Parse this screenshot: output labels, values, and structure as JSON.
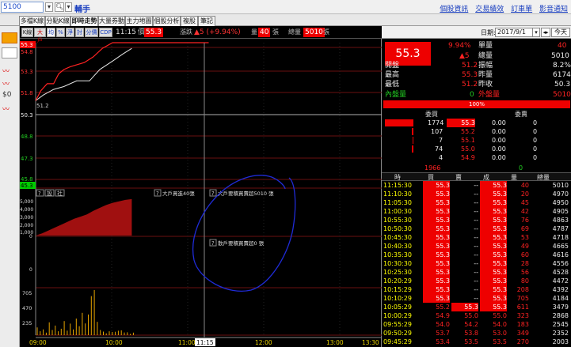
{
  "topbar": {
    "stock_code": "5100",
    "stock_name": "輔手",
    "links": [
      "個股資訊",
      "交易績效",
      "訂車單",
      "影音通知"
    ]
  },
  "tabs": [
    "多檔K線",
    "分點K線",
    "即時走勢",
    "大量券動",
    "主力地圖",
    "個股分析",
    "複股",
    "筆記"
  ],
  "active_tab": 2,
  "toolbar": {
    "buttons": [
      "K線",
      "大戶",
      "均",
      "%",
      "淨",
      "討",
      "分價",
      "CDP"
    ],
    "time": "11:15",
    "price_label": "價",
    "price_value": "55.3",
    "change_label": "漲跌",
    "change_value": "▲5 (+9.94%)",
    "vol_label": "量",
    "vol_value": "40",
    "vol_unit": "張",
    "total_label": "總量",
    "total_value": "5010",
    "total_unit": "張"
  },
  "chart": {
    "price_ticks": [
      "54.8",
      "53.3",
      "51.8",
      "50.3",
      "48.8",
      "47.3",
      "45.8"
    ],
    "top_price": "55.3",
    "bottom_price": "45.3",
    "start_label": "51.2",
    "panel2_ticks": [
      "5,000",
      "4,000",
      "3,000",
      "2,000",
      "1,000",
      "0"
    ],
    "panel2_buttons": [
      "?",
      "設",
      "社"
    ],
    "panel2_labels": [
      "大戶買進40張",
      "大戶要積買賣超5010 張"
    ],
    "panel3_label": "散戶要積買賣超0 張",
    "panel3_tick": "0",
    "vol_ticks": [
      "705",
      "470",
      "235"
    ],
    "time_ticks": [
      "09:00",
      "10:00",
      "11:00",
      "12:00",
      "13:00",
      "13:30"
    ],
    "cursor_time": "11:15"
  },
  "chart_data": {
    "type": "line",
    "x": [
      "09:00",
      "10:00",
      "11:00",
      "11:15"
    ],
    "series": [
      {
        "values": [
          51.2,
          53.9,
          55.3,
          55.3
        ]
      },
      {
        "values": [
          51.2,
          52.6,
          54.5,
          54.9
        ]
      }
    ],
    "ylim": [
      45.3,
      55.3
    ]
  },
  "right": {
    "date_label": "日期:",
    "date_value": "2017/9/1",
    "today_label": "今天",
    "big_price": "55.3",
    "pct": "9.94%",
    "change": "▲5",
    "single_vol_label": "單量",
    "single_vol": "40",
    "total_vol_label": "總量",
    "total_vol": "5010",
    "rows": [
      {
        "l": "開盤",
        "v": "51.2",
        "l2": "振幅",
        "v2": "8.2%"
      },
      {
        "l": "最高",
        "v": "55.3",
        "l2": "昨量",
        "v2": "6174"
      },
      {
        "l": "最低",
        "v": "51.2",
        "l2": "昨收",
        "v2": "50.3"
      }
    ],
    "inner_label": "內盤量",
    "inner_value": "0",
    "outer_label": "外盤量",
    "outer_value": "5010",
    "ratio": "100%",
    "buy_hdr": "委買",
    "sell_hdr": "委賣",
    "orderbook": [
      {
        "q": "1774",
        "p": "55.3",
        "sp": "0.00",
        "sq": "0"
      },
      {
        "q": "107",
        "p": "55.2",
        "sp": "0.00",
        "sq": "0"
      },
      {
        "q": "7",
        "p": "55.1",
        "sp": "0.00",
        "sq": "0"
      },
      {
        "q": "74",
        "p": "55.0",
        "sp": "0.00",
        "sq": "0"
      },
      {
        "q": "4",
        "p": "54.9",
        "sp": "0.00",
        "sq": "0"
      }
    ],
    "ob_total_buy": "1966",
    "ob_total_sell": "0",
    "tick_hdr": [
      "時",
      "買",
      "賣",
      "成",
      "量",
      "總量"
    ],
    "ticks": [
      [
        "11:15:30",
        "55.3",
        "--",
        "55.3",
        "40",
        "5010"
      ],
      [
        "11:10:30",
        "55.3",
        "--",
        "55.3",
        "20",
        "4970"
      ],
      [
        "11:05:30",
        "55.3",
        "--",
        "55.3",
        "45",
        "4950"
      ],
      [
        "11:00:30",
        "55.3",
        "--",
        "55.3",
        "42",
        "4905"
      ],
      [
        "10:55:30",
        "55.3",
        "--",
        "55.3",
        "76",
        "4863"
      ],
      [
        "10:50:30",
        "55.3",
        "--",
        "55.3",
        "69",
        "4787"
      ],
      [
        "10:45:30",
        "55.3",
        "--",
        "55.3",
        "53",
        "4718"
      ],
      [
        "10:40:30",
        "55.3",
        "--",
        "55.3",
        "49",
        "4665"
      ],
      [
        "10:35:30",
        "55.3",
        "--",
        "55.3",
        "60",
        "4616"
      ],
      [
        "10:30:30",
        "55.3",
        "--",
        "55.3",
        "28",
        "4556"
      ],
      [
        "10:25:30",
        "55.3",
        "--",
        "55.3",
        "56",
        "4528"
      ],
      [
        "10:20:29",
        "55.3",
        "--",
        "55.3",
        "80",
        "4472"
      ],
      [
        "10:15:29",
        "55.3",
        "--",
        "55.3",
        "208",
        "4392"
      ],
      [
        "10:10:29",
        "55.3",
        "--",
        "55.3",
        "705",
        "4184"
      ],
      [
        "10:05:29",
        "55.2",
        "55.3",
        "55.3",
        "611",
        "3479"
      ],
      [
        "10:00:29",
        "54.9",
        "55.0",
        "55.0",
        "323",
        "2868"
      ],
      [
        "09:55:29",
        "54.0",
        "54.2",
        "54.0",
        "183",
        "2545"
      ],
      [
        "09:50:29",
        "53.7",
        "53.8",
        "53.0",
        "349",
        "2352"
      ],
      [
        "09:45:29",
        "53.4",
        "53.5",
        "53.5",
        "270",
        "2003"
      ]
    ]
  },
  "colors": {
    "up": "#ff2222",
    "avg": "#e6e6e6",
    "annotation": "#1f2bd6"
  }
}
